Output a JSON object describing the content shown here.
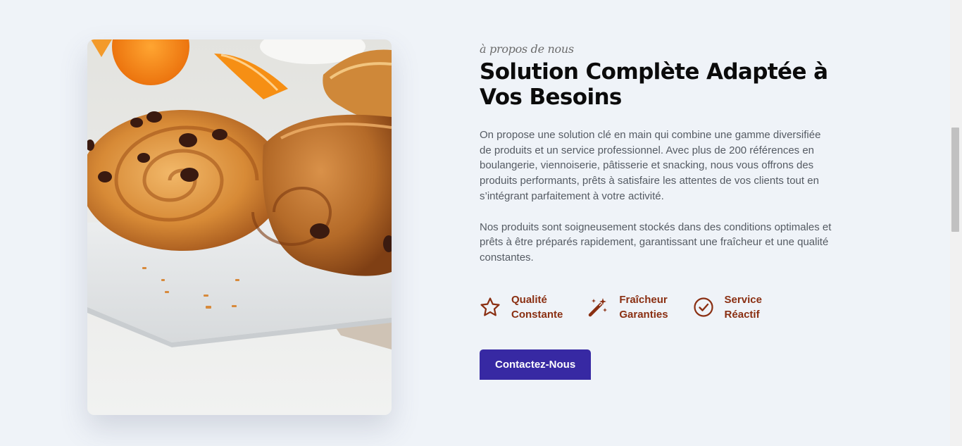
{
  "about": {
    "eyebrow": "à propos de nous",
    "title": "Solution Complète Adaptée à Vos Besoins",
    "paragraph_1": "On propose une solution clé en main qui combine une gamme diversifiée de produits et un service professionnel. Avec plus de 200 références en boulangerie, viennoiserie, pâtisserie et snacking, nous vous offrons des produits performants, prêts à satisfaire les attentes de vos clients tout en s’intégrant parfaitement à votre activité.",
    "paragraph_2": "Nos produits sont soigneusement stockés dans des conditions optimales et prêts à être préparés rapidement, garantissant une fraîcheur et une qualité constantes.",
    "features": [
      {
        "icon": "star-icon",
        "line1": "Qualité",
        "line2": "Constante"
      },
      {
        "icon": "magic-wand-icon",
        "line1": "Fraîcheur",
        "line2": "Garanties"
      },
      {
        "icon": "check-circle-icon",
        "line1": "Service",
        "line2": "Réactif"
      }
    ],
    "cta_label": "Contactez-Nous"
  },
  "image": {
    "subject": "pastries-photo"
  },
  "colors": {
    "background": "#eff3f8",
    "accent_brown": "#8a2f12",
    "button_blue": "#3729a3",
    "heading": "#0b0b0b",
    "body_text": "#555b63"
  }
}
